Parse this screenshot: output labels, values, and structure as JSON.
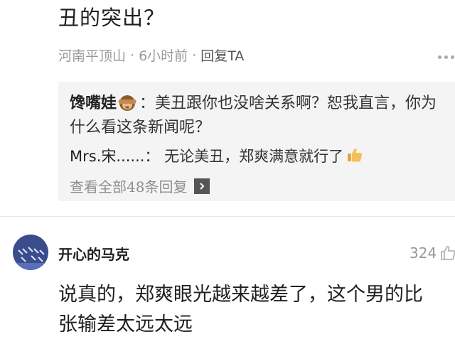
{
  "comment_prev": {
    "text_tail": "丑的突出？",
    "location": "河南平顶山",
    "separator": "·",
    "time": "6小时前",
    "reply_label": "回复TA"
  },
  "replies": [
    {
      "author": "馋嘴娃",
      "emoji_icon": "see-no-evil-monkey-icon",
      "text": "：美丑跟你也没啥关系啊？恕我直言，你为什么看这条新闻呢？"
    },
    {
      "author": "Mrs.宋......",
      "text": "：  无论美丑，郑爽满意就行了",
      "emoji_icon": "thumbs-up-icon"
    }
  ],
  "view_all_label": "查看全部48条回复",
  "comment": {
    "username": "开心的马克",
    "likes": "324",
    "text_line1": "说真的，郑爽眼光越来越差了，这个男的比",
    "text_line2": "张输差太远太远"
  },
  "colors": {
    "reply_bg": "#f4f4f4",
    "meta_gray": "#9a9a9a",
    "avatar_bg": "#4a5a9a"
  }
}
